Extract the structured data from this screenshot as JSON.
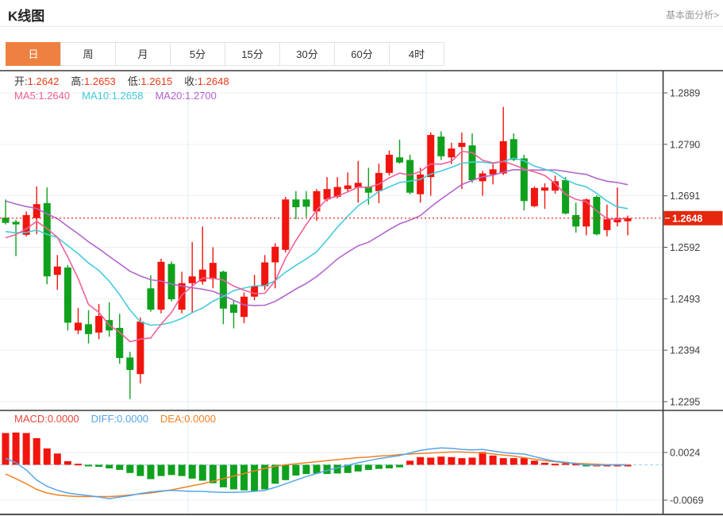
{
  "page": {
    "title": "K线图",
    "link_label": "基本面分析>"
  },
  "tabs": {
    "items": [
      "日",
      "周",
      "月",
      "5分",
      "15分",
      "30分",
      "60分",
      "4时"
    ],
    "active_index": 0
  },
  "price_header": {
    "items": [
      {
        "label": "开:",
        "value": "1.2642"
      },
      {
        "label": "高:",
        "value": "1.2653"
      },
      {
        "label": "低:",
        "value": "1.2615"
      },
      {
        "label": "收:",
        "value": "1.2648"
      }
    ]
  },
  "ma_header": {
    "items": [
      {
        "label": "MA5:",
        "value": "1.2640",
        "color": "#ef5c8e"
      },
      {
        "label": "MA10:",
        "value": "1.2658",
        "color": "#3cc9da"
      },
      {
        "label": "MA20:",
        "value": "1.2700",
        "color": "#b25fd0"
      }
    ]
  },
  "macd_header": {
    "items": [
      {
        "label": "MACD:",
        "value": "0.0000",
        "color": "#e8463a"
      },
      {
        "label": "DIFF:",
        "value": "0.0000",
        "color": "#54a5ea"
      },
      {
        "label": "DEA:",
        "value": "0.0000",
        "color": "#f08224"
      }
    ]
  },
  "axis": {
    "price_ticks": [
      "1.2889",
      "1.2790",
      "1.2691",
      "1.2592",
      "1.2493",
      "1.2394",
      "1.2295"
    ],
    "macd_ticks": [
      "0.0024",
      "-0.0069"
    ],
    "current_price": "1.2648"
  },
  "chart_data": {
    "type": "candlestick",
    "title": "K线图",
    "price_ylim": [
      1.2295,
      1.2889
    ],
    "macd_ylim": [
      -0.0069,
      0.0024
    ],
    "current_price": 1.2648,
    "legend": [
      "MA5",
      "MA10",
      "MA20",
      "MACD",
      "DIFF",
      "DEA"
    ],
    "candles": [
      [
        1.2649,
        1.2684,
        1.2636,
        1.2639
      ],
      [
        1.2641,
        1.2645,
        1.2575,
        1.2636
      ],
      [
        1.2616,
        1.2661,
        1.2613,
        1.2654
      ],
      [
        1.2648,
        1.2709,
        1.2617,
        1.2675
      ],
      [
        1.2677,
        1.2707,
        1.2521,
        1.2536
      ],
      [
        1.2539,
        1.2577,
        1.251,
        1.2555
      ],
      [
        1.2553,
        1.2558,
        1.2432,
        1.2447
      ],
      [
        1.2432,
        1.2475,
        1.2425,
        1.2447
      ],
      [
        1.2444,
        1.2471,
        1.2407,
        1.2425
      ],
      [
        1.2428,
        1.2483,
        1.2415,
        1.246
      ],
      [
        1.2452,
        1.2486,
        1.242,
        1.2432
      ],
      [
        1.2437,
        1.2464,
        1.2368,
        1.2379
      ],
      [
        1.238,
        1.2391,
        1.23,
        1.2356
      ],
      [
        1.2348,
        1.2457,
        1.233,
        1.2449
      ],
      [
        1.2513,
        1.2538,
        1.2468,
        1.2472
      ],
      [
        1.2472,
        1.257,
        1.2465,
        1.2564
      ],
      [
        1.256,
        1.2565,
        1.2488,
        1.2492
      ],
      [
        1.2472,
        1.2545,
        1.2465,
        1.2523
      ],
      [
        1.2523,
        1.2602,
        1.2465,
        1.2536
      ],
      [
        1.2526,
        1.2632,
        1.252,
        1.2549
      ],
      [
        1.2531,
        1.2592,
        1.2513,
        1.2562
      ],
      [
        1.2545,
        1.2547,
        1.2444,
        1.2474
      ],
      [
        1.2482,
        1.249,
        1.2436,
        1.2466
      ],
      [
        1.2458,
        1.2505,
        1.2446,
        1.2497
      ],
      [
        1.2497,
        1.2539,
        1.249,
        1.2517
      ],
      [
        1.2517,
        1.2577,
        1.251,
        1.2563
      ],
      [
        1.2563,
        1.26,
        1.2513,
        1.2593
      ],
      [
        1.2587,
        1.2689,
        1.2582,
        1.2684
      ],
      [
        1.2684,
        1.27,
        1.2646,
        1.2669
      ],
      [
        1.2684,
        1.27,
        1.265,
        1.267
      ],
      [
        1.2661,
        1.2704,
        1.2643,
        1.27
      ],
      [
        1.2684,
        1.2727,
        1.268,
        1.2704
      ],
      [
        1.2689,
        1.2727,
        1.2686,
        1.2708
      ],
      [
        1.2704,
        1.2736,
        1.2699,
        1.2711
      ],
      [
        1.2707,
        1.2758,
        1.2678,
        1.2716
      ],
      [
        1.2709,
        1.2745,
        1.2674,
        1.2697
      ],
      [
        1.27,
        1.2753,
        1.2677,
        1.2735
      ],
      [
        1.2735,
        1.2778,
        1.273,
        1.277
      ],
      [
        1.2765,
        1.2799,
        1.2753,
        1.2755
      ],
      [
        1.276,
        1.277,
        1.2694,
        1.2697
      ],
      [
        1.2694,
        1.2745,
        1.2678,
        1.2732
      ],
      [
        1.2727,
        1.2813,
        1.2691,
        1.2808
      ],
      [
        1.2805,
        1.2815,
        1.276,
        1.2767
      ],
      [
        1.2765,
        1.2793,
        1.2752,
        1.2782
      ],
      [
        1.2785,
        1.2813,
        1.2704,
        1.2793
      ],
      [
        1.2788,
        1.2811,
        1.2716,
        1.2721
      ],
      [
        1.2719,
        1.2739,
        1.2691,
        1.2734
      ],
      [
        1.2732,
        1.2752,
        1.2713,
        1.2742
      ],
      [
        1.2734,
        1.2862,
        1.2731,
        1.2796
      ],
      [
        1.28,
        1.2811,
        1.2758,
        1.276
      ],
      [
        1.2763,
        1.277,
        1.2663,
        1.2681
      ],
      [
        1.2671,
        1.2709,
        1.2669,
        1.2706
      ],
      [
        1.2701,
        1.2715,
        1.2666,
        1.2707
      ],
      [
        1.2701,
        1.273,
        1.2695,
        1.2719
      ],
      [
        1.2721,
        1.2727,
        1.2655,
        1.2657
      ],
      [
        1.2654,
        1.2678,
        1.262,
        1.2632
      ],
      [
        1.2632,
        1.2686,
        1.2615,
        1.2684
      ],
      [
        1.2689,
        1.2692,
        1.2615,
        1.2617
      ],
      [
        1.2625,
        1.2674,
        1.2613,
        1.2646
      ],
      [
        1.264,
        1.2707,
        1.2632,
        1.2648
      ],
      [
        1.2642,
        1.2653,
        1.2615,
        1.2648
      ]
    ],
    "ma_periods": [
      5,
      10,
      20
    ],
    "ma_seed_closes": [
      1.275,
      1.2755,
      1.275,
      1.2748,
      1.2745,
      1.2742,
      1.2738,
      1.2735,
      1.2732,
      1.273,
      1.2725,
      1.266,
      1.2645,
      1.263,
      1.262,
      1.2615,
      1.2605,
      1.26,
      1.2603,
      1.2605
    ],
    "macd": {
      "hist": [
        0.0062,
        0.0063,
        0.0062,
        0.0052,
        0.0032,
        0.0022,
        0.0007,
        0.0002,
        -0.0002,
        -0.0004,
        -0.0007,
        -0.001,
        -0.0016,
        -0.0022,
        -0.0028,
        -0.0022,
        -0.002,
        -0.0022,
        -0.0027,
        -0.0031,
        -0.0036,
        -0.0044,
        -0.0048,
        -0.005,
        -0.0051,
        -0.0048,
        -0.0037,
        -0.003,
        -0.0021,
        -0.0018,
        -0.0017,
        -0.0018,
        -0.0017,
        -0.0016,
        -0.0013,
        -0.001,
        -0.0008,
        -0.0007,
        -0.0005,
        0.0008,
        0.0015,
        0.0014,
        0.0016,
        0.0015,
        0.0013,
        0.0014,
        0.0025,
        0.0018,
        0.0013,
        0.0013,
        0.0013,
        0.0008,
        0.0004,
        0.0002,
        0.0003,
        0.0002,
        -0.0003,
        0.0,
        0.0,
        0.0,
        0.0
      ],
      "diff": [
        0.0013,
        0.0004,
        -0.001,
        -0.003,
        -0.0042,
        -0.005,
        -0.0055,
        -0.0058,
        -0.006,
        -0.0063,
        -0.0066,
        -0.0063,
        -0.006,
        -0.0056,
        -0.0053,
        -0.0051,
        -0.005,
        -0.0051,
        -0.0052,
        -0.0052,
        -0.0053,
        -0.0054,
        -0.0054,
        -0.0053,
        -0.0052,
        -0.005,
        -0.0044,
        -0.0037,
        -0.003,
        -0.0023,
        -0.0017,
        -0.0011,
        -0.0006,
        -0.0001,
        0.0004,
        0.0008,
        0.0012,
        0.0015,
        0.0018,
        0.0023,
        0.0028,
        0.0031,
        0.0033,
        0.0032,
        0.003,
        0.0029,
        0.003,
        0.0027,
        0.0024,
        0.0022,
        0.0021,
        0.0016,
        0.0011,
        0.0007,
        0.0005,
        0.0002,
        0.0,
        -0.0001,
        0.0,
        0.0,
        0.0
      ],
      "dea": [
        -0.0018,
        -0.0027,
        -0.0037,
        -0.0048,
        -0.0055,
        -0.0059,
        -0.0061,
        -0.0062,
        -0.0062,
        -0.0062,
        -0.0062,
        -0.0061,
        -0.0059,
        -0.0057,
        -0.0055,
        -0.0052,
        -0.0049,
        -0.0045,
        -0.0041,
        -0.0037,
        -0.0032,
        -0.0027,
        -0.0022,
        -0.0017,
        -0.0012,
        -0.0007,
        -0.0003,
        0.0,
        0.0002,
        0.0004,
        0.0006,
        0.0008,
        0.001,
        0.0012,
        0.0014,
        0.0015,
        0.0017,
        0.0018,
        0.002,
        0.0021,
        0.0022,
        0.0023,
        0.0024,
        0.0025,
        0.0025,
        0.0024,
        0.0023,
        0.0021,
        0.0019,
        0.0017,
        0.0014,
        0.0011,
        0.0008,
        0.0006,
        0.0004,
        0.0003,
        0.0002,
        0.0001,
        0.0,
        0.0,
        0.0
      ]
    },
    "colors": {
      "up": "#f0150e",
      "down": "#0fa11d",
      "ma5": "#f0609a",
      "ma10": "#45ccdc",
      "ma20": "#b266cc",
      "diff": "#54a5ea",
      "dea": "#f08224",
      "price_line": "#f0150e",
      "badge_bg": "#e5270d",
      "grid": "#e9f0f6",
      "vgrid": "#dcebf6",
      "zero_dash": "#a9d9ef",
      "axis_text": "#3c3c3c",
      "border": "#3a3a3a",
      "tab_active_bg": "#ee8142"
    }
  }
}
